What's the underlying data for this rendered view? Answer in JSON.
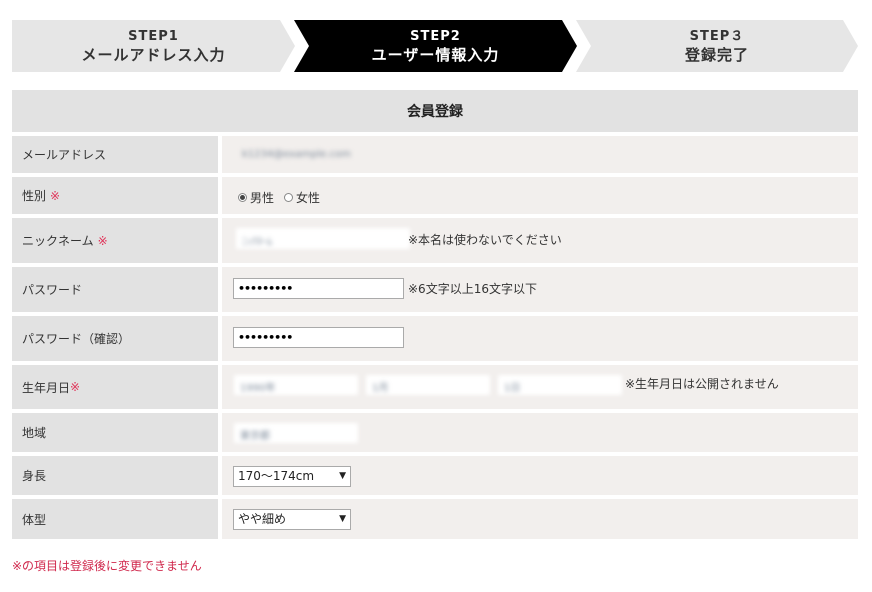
{
  "steps": [
    {
      "num": "STEP1",
      "label": "メールアドレス入力"
    },
    {
      "num": "STEP2",
      "label": "ユーザー情報入力"
    },
    {
      "num": "STEP３",
      "label": "登録完了"
    }
  ],
  "form": {
    "title": "会員登録",
    "required_mark": "※",
    "email": {
      "label": "メールアドレス",
      "value": "k1234@example.com"
    },
    "gender": {
      "label": "性別",
      "options": [
        "男性",
        "女性"
      ],
      "selected": "男性"
    },
    "nickname": {
      "label": "ニックネーム",
      "value": "ﾆｯｸﾈｰﾑ",
      "note": "※本名は使わないでください"
    },
    "password": {
      "label": "パスワード",
      "value": "•••••••••",
      "note": "※6文字以上16文字以下"
    },
    "password_confirm": {
      "label": "パスワード（確認）",
      "value": "•••••••••"
    },
    "birthdate": {
      "label": "生年月日",
      "year": "1990年",
      "month": "1月",
      "day": "1日",
      "note": "※生年月日は公開されません"
    },
    "region": {
      "label": "地域",
      "value": "東京都"
    },
    "height": {
      "label": "身長",
      "value": "170〜174cm",
      "arrow": "▼"
    },
    "body_type": {
      "label": "体型",
      "value": "やや細め",
      "arrow": "▼"
    }
  },
  "footnote": "※の項目は登録後に変更できません"
}
